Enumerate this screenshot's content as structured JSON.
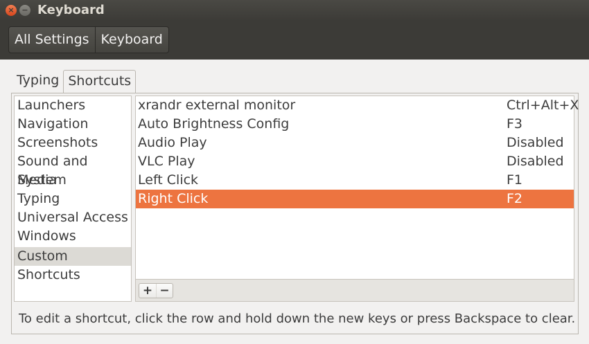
{
  "window": {
    "title": "Keyboard",
    "close_glyph": "×",
    "min_glyph": "−"
  },
  "breadcrumbs": [
    "All Settings",
    "Keyboard"
  ],
  "tabs": [
    "Typing",
    "Shortcuts"
  ],
  "active_tab": "Shortcuts",
  "sidebar": {
    "items": [
      "Launchers",
      "Navigation",
      "Screenshots",
      "Sound and Media",
      "System",
      "Typing",
      "Universal Access",
      "Windows",
      "Custom Shortcuts"
    ],
    "selected": "Custom Shortcuts"
  },
  "shortcuts": [
    {
      "name": "xrandr external monitor",
      "accel": "Ctrl+Alt+X"
    },
    {
      "name": "Auto Brightness Config",
      "accel": "F3"
    },
    {
      "name": "Audio Play",
      "accel": "Disabled"
    },
    {
      "name": "VLC Play",
      "accel": "Disabled"
    },
    {
      "name": "Left Click",
      "accel": "F1"
    },
    {
      "name": "Right Click",
      "accel": "F2"
    }
  ],
  "selected_shortcut": "Right Click",
  "list_tools": {
    "add": "+",
    "remove": "−"
  },
  "hint": "To edit a shortcut, click the row and hold down the new keys or press Backspace to clear.",
  "colors": {
    "selection": "#ed7440",
    "titlebar": "#3c3b37",
    "close_button": "#e5521f"
  }
}
